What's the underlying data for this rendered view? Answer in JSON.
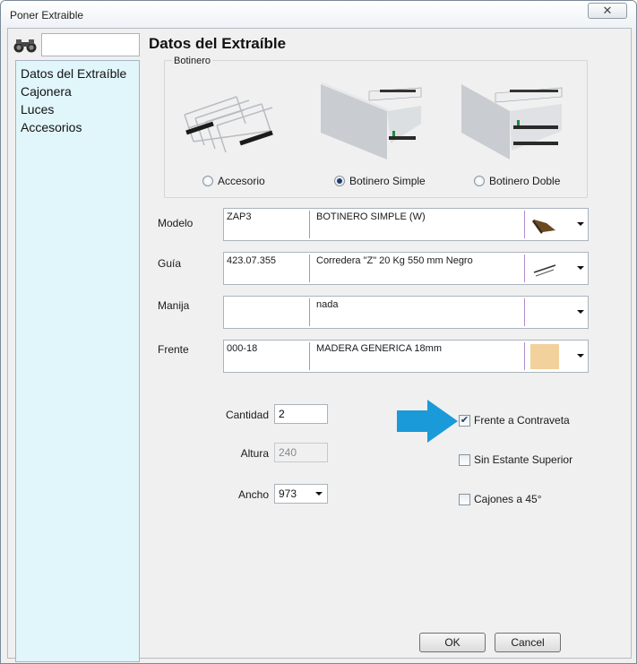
{
  "window": {
    "title": "Poner Extraible",
    "close_label": "✕"
  },
  "search": {
    "placeholder": "",
    "value": ""
  },
  "tree": {
    "items": [
      "Datos del Extraíble",
      "Cajonera",
      "Luces",
      "Accesorios"
    ]
  },
  "page": {
    "heading": "Datos del Extraíble"
  },
  "botinero": {
    "legend": "Botinero",
    "options": [
      {
        "label": "Accesorio",
        "selected": false
      },
      {
        "label": "Botinero Simple",
        "selected": true
      },
      {
        "label": "Botinero Doble",
        "selected": false
      }
    ]
  },
  "rows": [
    {
      "label": "Modelo",
      "code": "ZAP3",
      "desc": "BOTINERO SIMPLE (W)",
      "thumb": "shoe-rack-thumbnail"
    },
    {
      "label": "Guía",
      "code": "423.07.355",
      "desc": "Corredera \"Z\" 20 Kg 550 mm Negro",
      "thumb": "rail-thumbnail"
    },
    {
      "label": "Manija",
      "code": "",
      "desc": "nada",
      "thumb": ""
    },
    {
      "label": "Frente",
      "code": "000-18",
      "desc": "MADERA GENERICA 18mm",
      "thumb": "wood-swatch"
    }
  ],
  "fields": {
    "cantidad": {
      "label": "Cantidad",
      "value": "2"
    },
    "altura": {
      "label": "Altura",
      "value": "240"
    },
    "ancho": {
      "label": "Ancho",
      "value": "973"
    }
  },
  "checks": [
    {
      "label": "Frente a Contraveta",
      "checked": true
    },
    {
      "label": "Sin Estante Superior",
      "checked": false
    },
    {
      "label": "Cajones a 45°",
      "checked": false
    }
  ],
  "buttons": {
    "ok": "OK",
    "cancel": "Cancel"
  },
  "colors": {
    "tree_bg": "#e1f6fb",
    "arrow": "#1a9ad8",
    "wood": "#f2d19c"
  },
  "check_mark": "✔"
}
